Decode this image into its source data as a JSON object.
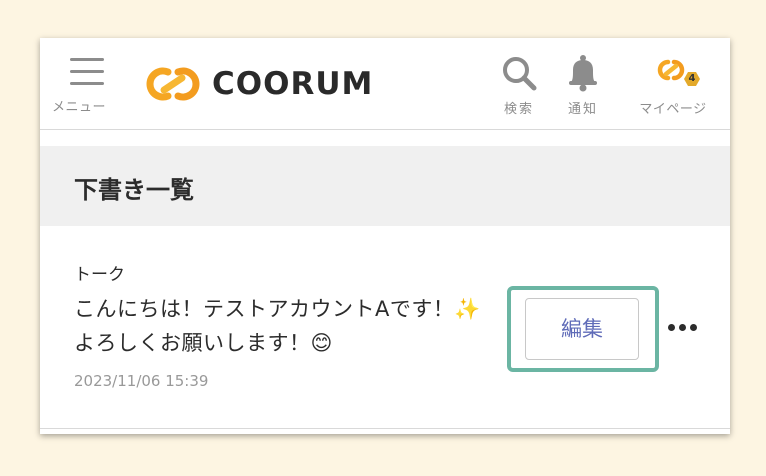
{
  "header": {
    "menu_label": "メニュー",
    "logo_text": "COORUM",
    "search_label": "検索",
    "notification_label": "通知",
    "mypage_label": "マイページ",
    "mypage_badge": "4"
  },
  "page": {
    "title": "下書き一覧"
  },
  "drafts": [
    {
      "category": "トーク",
      "body": "こんにちは！テストアカウントAです！✨ よろしくお願いします！😊",
      "timestamp": "2023/11/06 15:39",
      "edit_label": "編集"
    }
  ],
  "colors": {
    "background": "#fdf5e2",
    "highlight": "#6bb5a3",
    "edit_text": "#5f6bb8",
    "logo_orange": "#f5a623",
    "badge": "#e3a92a"
  },
  "icons": {
    "menu": "hamburger-icon",
    "search": "search-icon",
    "notification": "bell-icon",
    "mypage": "coorum-logo-icon",
    "more": "more-horizontal-icon"
  }
}
